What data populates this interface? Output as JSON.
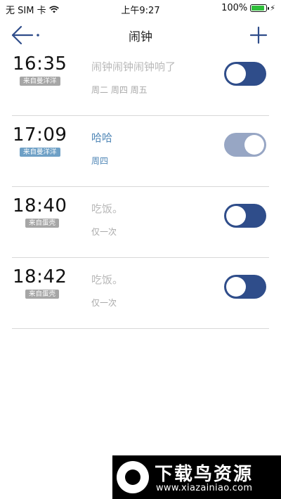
{
  "status_bar": {
    "carrier": "无 SIM 卡",
    "time": "上午9:27",
    "battery_percent": "100%",
    "battery_level": 1.0,
    "icons": [
      "wifi-icon",
      "battery-icon",
      "charging-bolt-icon"
    ]
  },
  "nav": {
    "title": "闹钟",
    "back_icon": "back-arrow-icon",
    "add_icon": "plus-icon"
  },
  "alarms": [
    {
      "time": "16:35",
      "source": "来自曼洋洋",
      "message": "闹钟闹钟闹钟响了",
      "days": "周二 周四 周五",
      "enabled": true,
      "active_style": false
    },
    {
      "time": "17:09",
      "source": "来自曼洋洋",
      "message": "哈哈",
      "days": "周四",
      "enabled": true,
      "active_style": true
    },
    {
      "time": "18:40",
      "source": "来自蛋壳",
      "message": "吃饭。",
      "days": "仅一次",
      "enabled": true,
      "active_style": false
    },
    {
      "time": "18:42",
      "source": "来自蛋壳",
      "message": "吃饭。",
      "days": "仅一次",
      "enabled": true,
      "active_style": false
    }
  ],
  "watermark": {
    "title": "下载鸟资源",
    "url": "www.xiazainiao.com"
  },
  "colors": {
    "toggle_on": "#2f4d8a",
    "toggle_dim": "#97a6c4",
    "accent_text": "#4f86b6",
    "tag_gray": "#a6a6a6",
    "tag_blue": "#6ea0c6"
  }
}
